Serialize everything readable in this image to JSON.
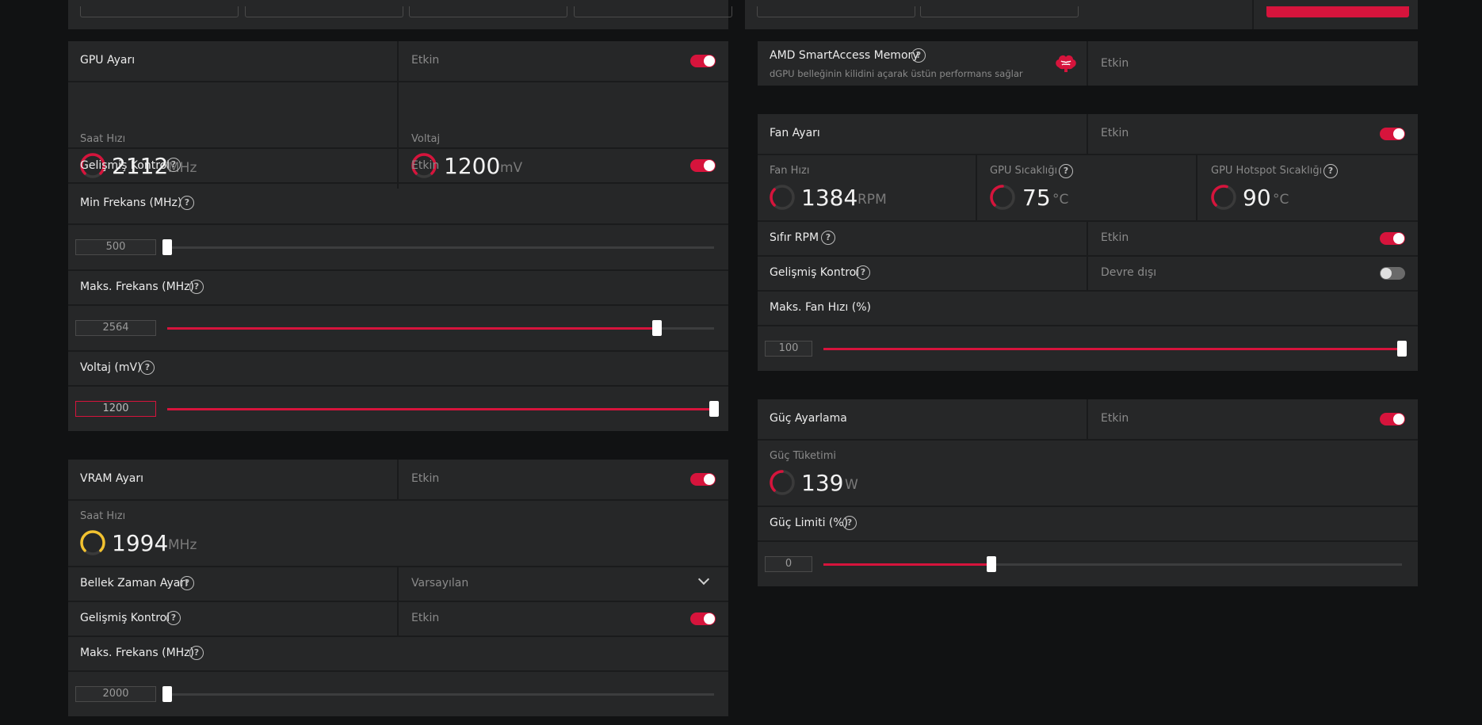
{
  "colors": {
    "accent": "#d6143c",
    "vram_gauge": "#f2c230",
    "panel": "#262728",
    "background": "#111213"
  },
  "gpu": {
    "title": "GPU Ayarı",
    "status": "Etkin",
    "enabled": true,
    "clock": {
      "label": "Saat Hızı",
      "value": "2112",
      "unit": "MHz"
    },
    "voltage": {
      "label": "Voltaj",
      "value": "1200",
      "unit": "mV"
    },
    "advanced": {
      "label": "Gelişmiş Kontrol",
      "status": "Etkin",
      "enabled": true
    },
    "min_freq": {
      "label": "Min Frekans (MHz)",
      "value": "500",
      "percent": 0
    },
    "max_freq": {
      "label": "Maks. Frekans (MHz)",
      "value": "2564",
      "percent": 89.5
    },
    "voltage_slider": {
      "label": "Voltaj (mV)",
      "value": "1200",
      "percent": 100
    }
  },
  "vram": {
    "title": "VRAM Ayarı",
    "status": "Etkin",
    "enabled": true,
    "clock": {
      "label": "Saat Hızı",
      "value": "1994",
      "unit": "MHz"
    },
    "timing": {
      "label": "Bellek Zaman Ayarı",
      "value": "Varsayılan"
    },
    "advanced": {
      "label": "Gelişmiş Kontrol",
      "status": "Etkin",
      "enabled": true
    },
    "max_freq": {
      "label": "Maks. Frekans (MHz)",
      "value": "2000",
      "percent": 0
    }
  },
  "sam": {
    "title": "AMD SmartAccess Memory",
    "subtitle": "dGPU belleğinin kilidini açarak üstün performans sağlar",
    "status": "Etkin",
    "icon": "brain-icon"
  },
  "fan": {
    "title": "Fan Ayarı",
    "status": "Etkin",
    "enabled": true,
    "speed": {
      "label": "Fan Hızı",
      "value": "1384",
      "unit": "RPM"
    },
    "gpu_temp": {
      "label": "GPU Sıcaklığı",
      "value": "75",
      "unit": "°C"
    },
    "hotspot_temp": {
      "label": "GPU Hotspot Sıcaklığı",
      "value": "90",
      "unit": "°C"
    },
    "zero_rpm": {
      "label": "Sıfır RPM",
      "status": "Etkin",
      "enabled": true
    },
    "advanced": {
      "label": "Gelişmiş Kontrol",
      "status": "Devre dışı",
      "enabled": false
    },
    "max_fan": {
      "label": "Maks. Fan Hızı (%)",
      "value": "100",
      "percent": 100
    }
  },
  "power": {
    "title": "Güç Ayarlama",
    "status": "Etkin",
    "enabled": true,
    "consumption": {
      "label": "Güç Tüketimi",
      "value": "139",
      "unit": "W"
    },
    "limit": {
      "label": "Güç Limiti (%)",
      "value": "0",
      "percent": 29
    }
  }
}
